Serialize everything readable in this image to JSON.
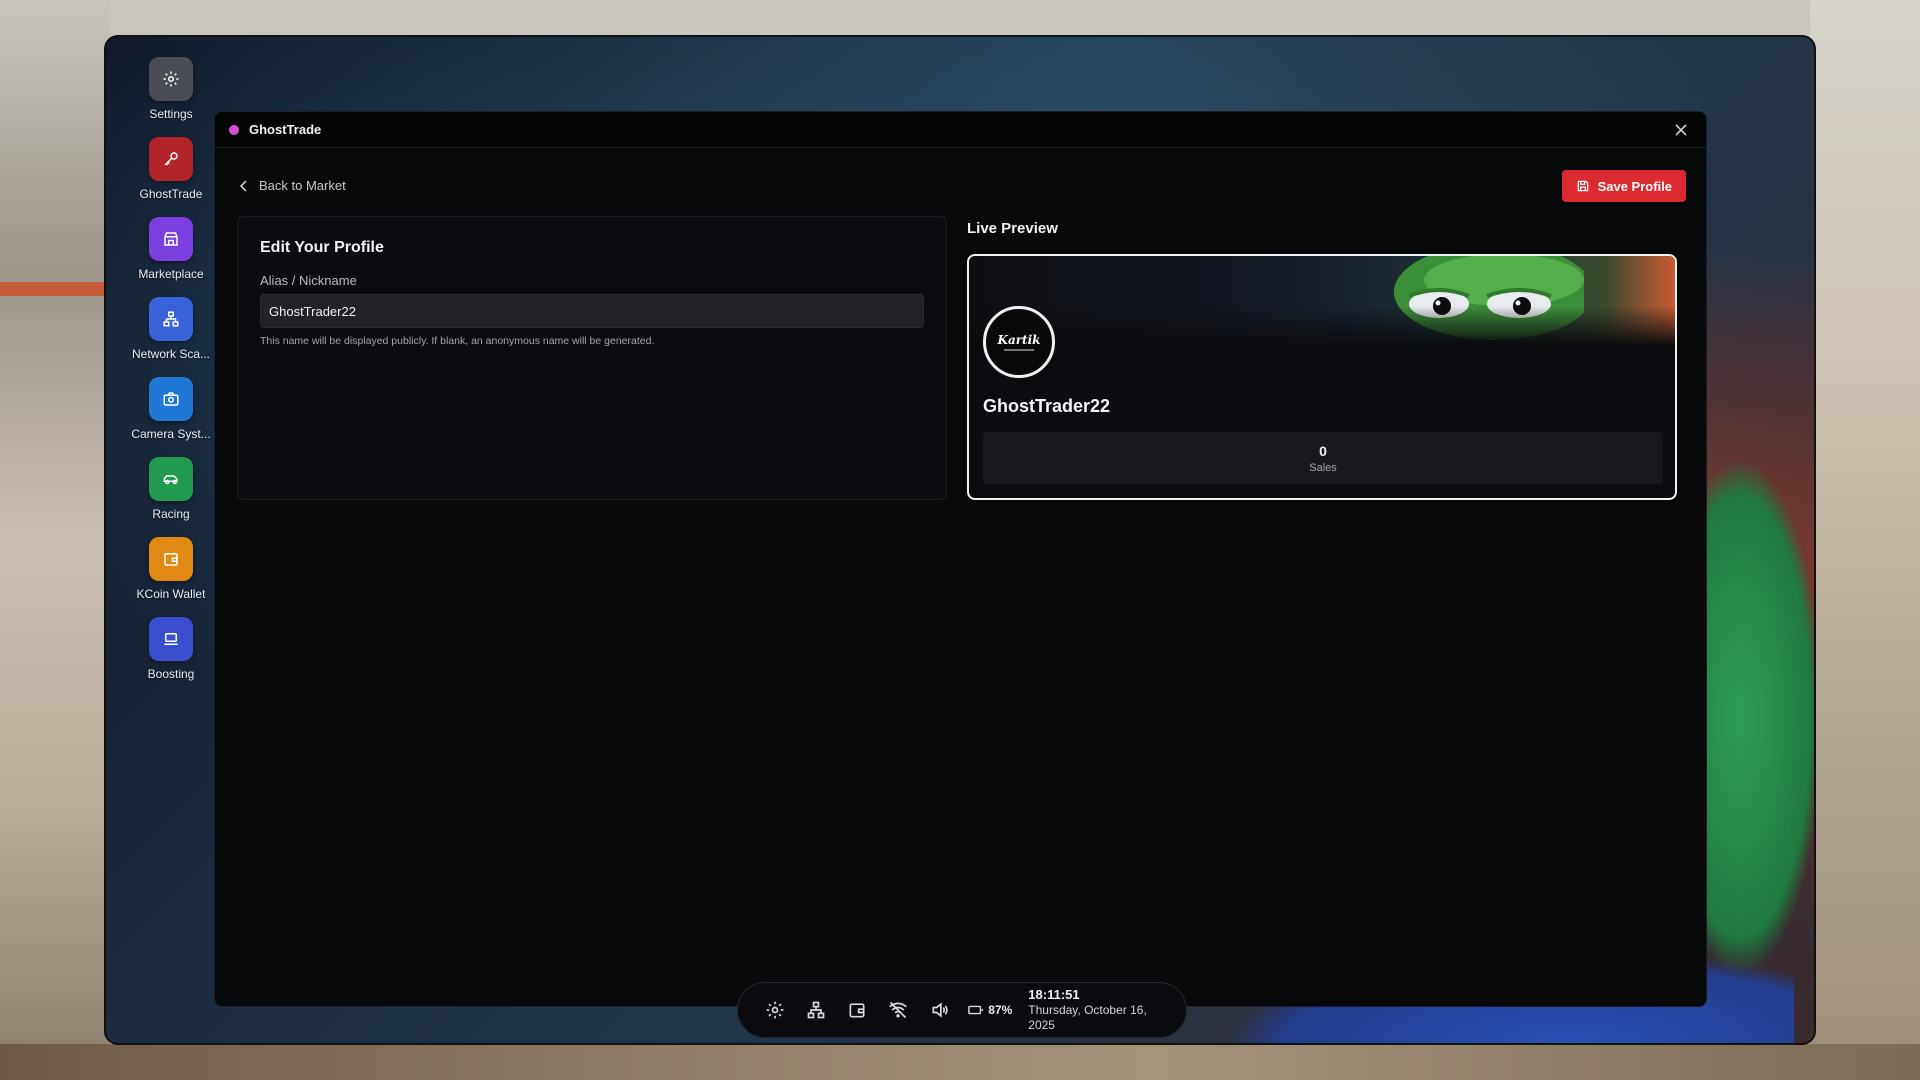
{
  "dock": {
    "items": [
      {
        "label": "Settings",
        "icon": "gear-icon",
        "color": "#4a4d55"
      },
      {
        "label": "GhostTrade",
        "icon": "key-icon",
        "color": "#b3242a"
      },
      {
        "label": "Marketplace",
        "icon": "store-icon",
        "color": "#7b3fe0"
      },
      {
        "label": "Network Sca...",
        "icon": "network-icon",
        "color": "#3a62d8"
      },
      {
        "label": "Camera Syst...",
        "icon": "camera-icon",
        "color": "#1f78d6"
      },
      {
        "label": "Racing",
        "icon": "car-icon",
        "color": "#1f9a4e"
      },
      {
        "label": "KCoin Wallet",
        "icon": "wallet-icon",
        "color": "#e08a14"
      },
      {
        "label": "Boosting",
        "icon": "laptop-icon",
        "color": "#3a4fd0"
      }
    ]
  },
  "window": {
    "title": "GhostTrade",
    "accent": "#d34fd8"
  },
  "toolbar": {
    "back_label": "Back to Market",
    "save_label": "Save Profile"
  },
  "edit_panel": {
    "title": "Edit Your Profile",
    "alias_label": "Alias / Nickname",
    "alias_value": "GhostTrader22",
    "alias_hint": "This name will be displayed publicly. If blank, an anonymous name will be generated."
  },
  "preview": {
    "title": "Live Preview",
    "avatar_text": "Kartik",
    "name": "GhostTrader22",
    "stats": {
      "value": "0",
      "label": "Sales"
    }
  },
  "taskbar": {
    "battery": "87%",
    "time": "18:11:51",
    "date": "Thursday, October 16, 2025"
  }
}
